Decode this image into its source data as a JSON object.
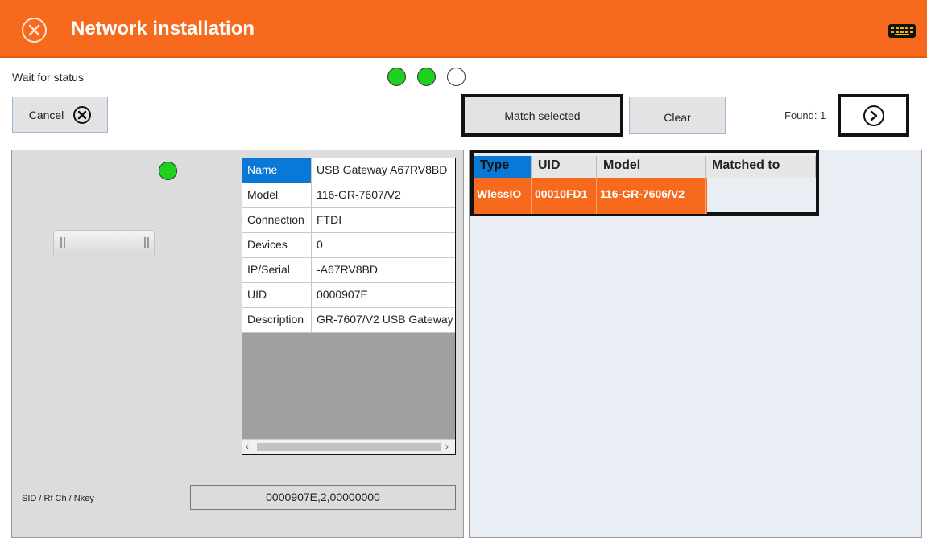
{
  "window": {
    "title": "Network installation"
  },
  "status": {
    "label": "Wait for status",
    "indicators": [
      "green",
      "green",
      "empty"
    ]
  },
  "toolbar": {
    "cancel_label": "Cancel",
    "match_label": "Match selected",
    "clear_label": "Clear",
    "found_text": "Found: 1"
  },
  "device": {
    "status": "green",
    "properties": [
      {
        "key": "Name",
        "value": "USB Gateway A67RV8BD"
      },
      {
        "key": "Model",
        "value": "116-GR-7607/V2"
      },
      {
        "key": "Connection",
        "value": "FTDI"
      },
      {
        "key": "Devices",
        "value": "0"
      },
      {
        "key": "IP/Serial",
        "value": "-A67RV8BD"
      },
      {
        "key": "UID",
        "value": "0000907E"
      },
      {
        "key": "Description",
        "value": "GR-7607/V2 USB Gateway"
      }
    ],
    "sid_label": "SID / Rf Ch / Nkey",
    "sid_value": "0000907E,2,00000000"
  },
  "found_table": {
    "columns": [
      "Type",
      "UID",
      "Model",
      "Matched to"
    ],
    "rows": [
      {
        "type": "WlessIO",
        "uid": "00010FD1",
        "model": "116-GR-7606/V2",
        "matched_to": ""
      }
    ]
  },
  "colors": {
    "accent": "#f76a1e",
    "selection": "#0a78d7",
    "status_green": "#1fd11f"
  },
  "icons": {
    "title_close": "close-circle-icon",
    "keyboard": "keyboard-icon",
    "cancel": "close-circle-icon",
    "next": "chevron-right-circle-icon"
  }
}
